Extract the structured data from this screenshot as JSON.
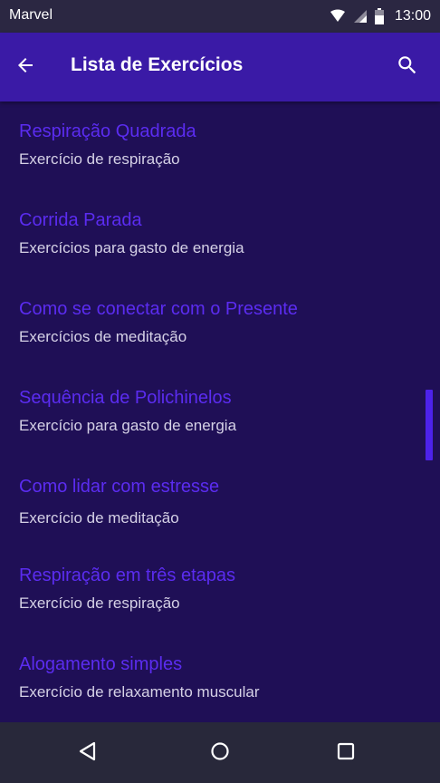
{
  "status_bar": {
    "carrier": "Marvel",
    "time": "13:00",
    "icons": [
      "wifi-icon",
      "signal-icon",
      "battery-icon"
    ]
  },
  "app_bar": {
    "title": "Lista de Exercícios",
    "back_icon": "arrow-left-icon",
    "search_icon": "search-icon"
  },
  "exercises": [
    {
      "title": "Respiração Quadrada",
      "subtitle": "Exercício de respiração"
    },
    {
      "title": "Corrida Parada",
      "subtitle": "Exercícios para gasto de energia"
    },
    {
      "title": "Como se conectar com o Presente",
      "subtitle": "Exercícios de meditação"
    },
    {
      "title": "Sequência de Polichinelos",
      "subtitle": "Exercício para gasto de energia"
    },
    {
      "title": "Como lidar com estresse",
      "subtitle": "Exercício de meditação"
    },
    {
      "title": "Respiração em três etapas",
      "subtitle": "Exercício de respiração"
    },
    {
      "title": "Alogamento simples",
      "subtitle": "Exercício de relaxamento muscular"
    }
  ],
  "nav_bar": {
    "icons": [
      "back-triangle-icon",
      "home-circle-icon",
      "recents-square-icon"
    ]
  },
  "colors": {
    "status_bar": "#2b2742",
    "app_bar": "#3a1aa6",
    "background": "#1f0f56",
    "item_title": "#5b2cf0",
    "item_subtitle": "#d5d1e6",
    "scroll_thumb": "#4d22ea",
    "nav_bar": "#28283a"
  }
}
